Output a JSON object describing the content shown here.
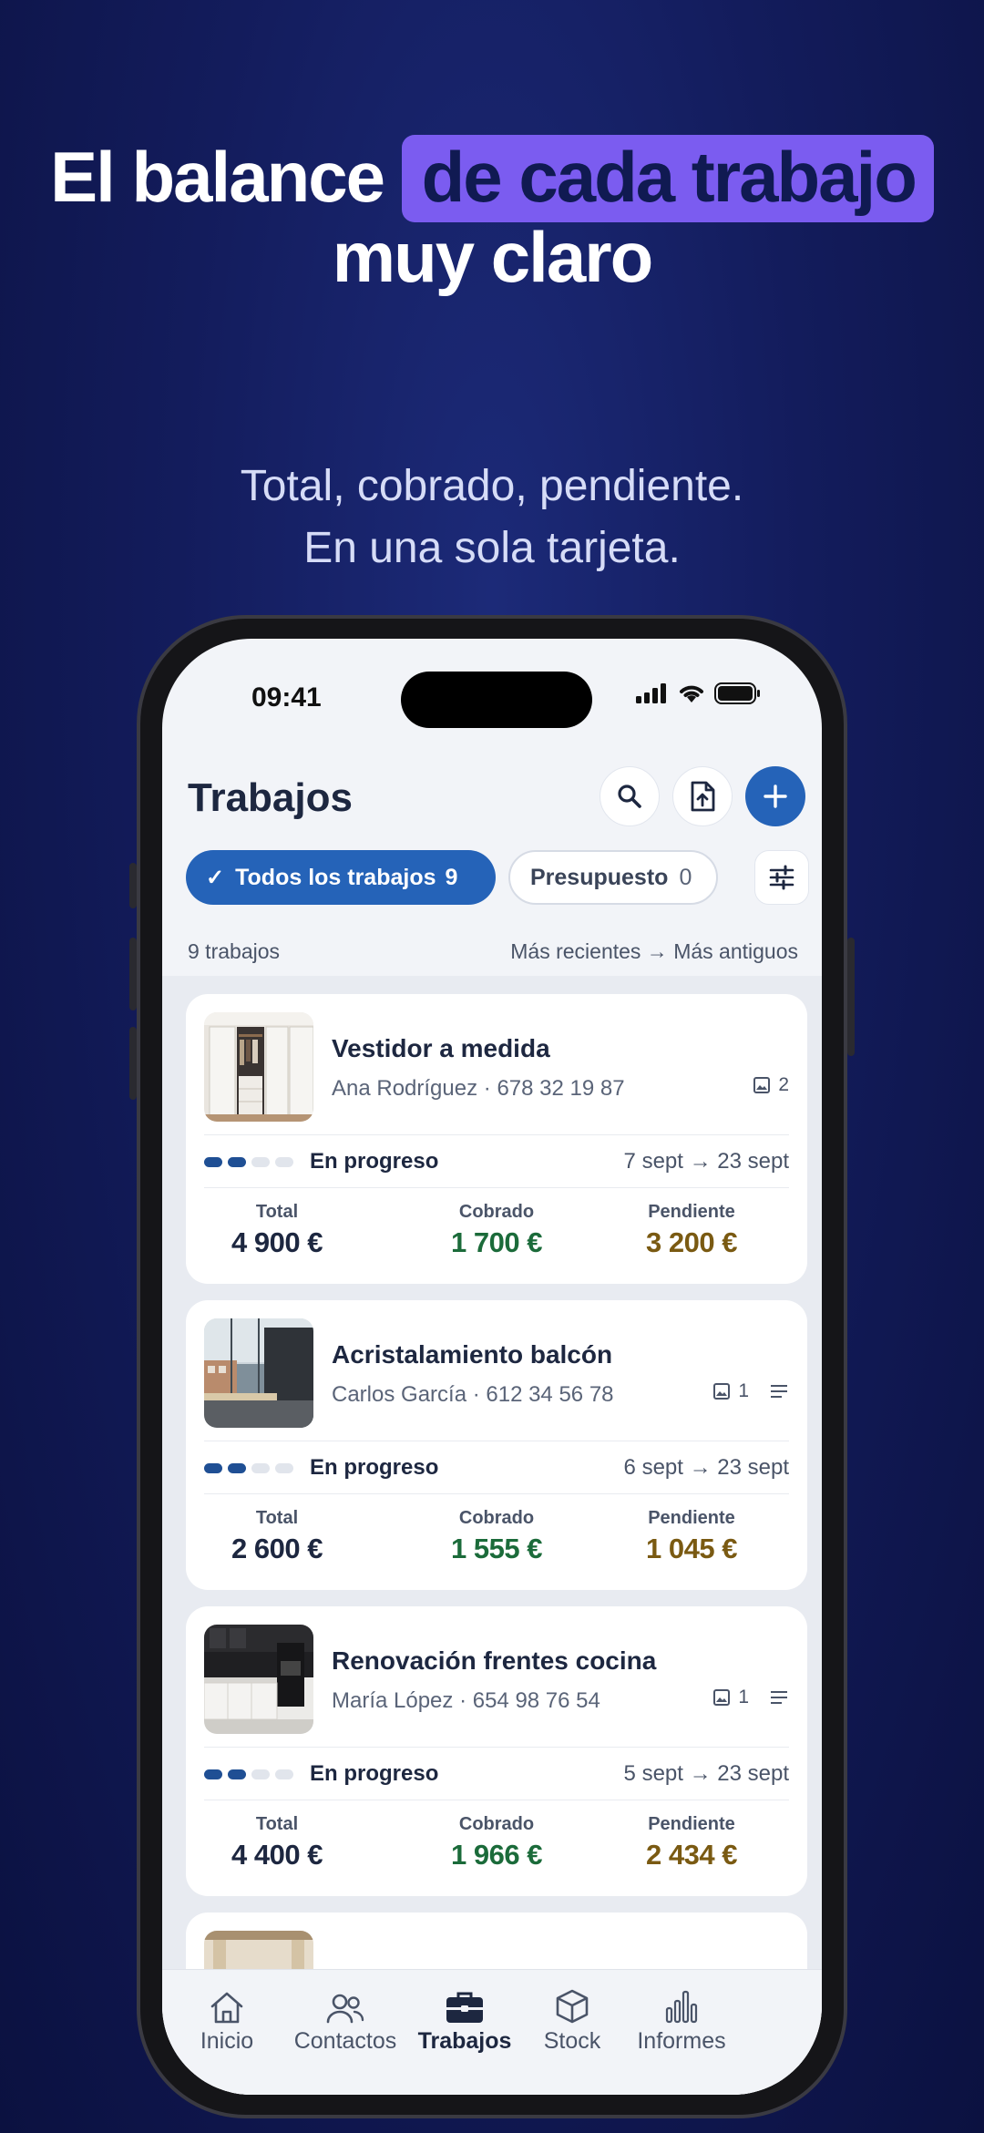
{
  "promo": {
    "headline_part1": "El balance",
    "headline_highlight": "de cada trabajo",
    "headline_line2": "muy claro",
    "subtitle_line1": "Total, cobrado, pendiente.",
    "subtitle_line2": "En una sola tarjeta."
  },
  "status_bar": {
    "time": "09:41"
  },
  "header": {
    "title": "Trabajos",
    "search_icon": "search-icon",
    "export_icon": "file-upload-icon",
    "add_icon": "plus-icon"
  },
  "filters": {
    "active": {
      "label": "Todos los trabajos",
      "count": "9"
    },
    "secondary": {
      "label": "Presupuesto",
      "count": "0"
    },
    "filter_icon": "sliders-icon"
  },
  "list_meta": {
    "count_text": "9 trabajos",
    "sort_text": "Más recientes → Más antiguos"
  },
  "amount_labels": {
    "total": "Total",
    "cobrado": "Cobrado",
    "pendiente": "Pendiente"
  },
  "jobs": [
    {
      "title": "Vestidor a medida",
      "client": "Ana Rodríguez",
      "phone": "678 32 19 87",
      "photos": "2",
      "has_notes": false,
      "status": "En progreso",
      "progress_steps": [
        true,
        true,
        false,
        false
      ],
      "dates": "7 sept → 23 sept",
      "total": "4 900 €",
      "cobrado": "1 700 €",
      "pendiente": "3 200 €"
    },
    {
      "title": "Acristalamiento balcón",
      "client": "Carlos García",
      "phone": "612 34 56 78",
      "photos": "1",
      "has_notes": true,
      "status": "En progreso",
      "progress_steps": [
        true,
        true,
        false,
        false
      ],
      "dates": "6 sept → 23 sept",
      "total": "2 600 €",
      "cobrado": "1 555 €",
      "pendiente": "1 045 €"
    },
    {
      "title": "Renovación frentes cocina",
      "client": "María López",
      "phone": "654 98 76 54",
      "photos": "1",
      "has_notes": true,
      "status": "En progreso",
      "progress_steps": [
        true,
        true,
        false,
        false
      ],
      "dates": "5 sept → 23 sept",
      "total": "4 400 €",
      "cobrado": "1 966 €",
      "pendiente": "2 434 €"
    }
  ],
  "tabbar": {
    "items": [
      {
        "label": "Inicio",
        "icon": "home-icon",
        "active": false
      },
      {
        "label": "Contactos",
        "icon": "contacts-icon",
        "active": false
      },
      {
        "label": "Trabajos",
        "icon": "briefcase-icon",
        "active": true
      },
      {
        "label": "Stock",
        "icon": "box-icon",
        "active": false
      },
      {
        "label": "Informes",
        "icon": "bar-chart-icon",
        "active": false
      }
    ]
  },
  "colors": {
    "background": "#131c5c",
    "highlight": "#7b5cf0",
    "primary": "#2563b8",
    "cobrado": "#1b6b3a",
    "pendiente": "#7a5a12"
  }
}
